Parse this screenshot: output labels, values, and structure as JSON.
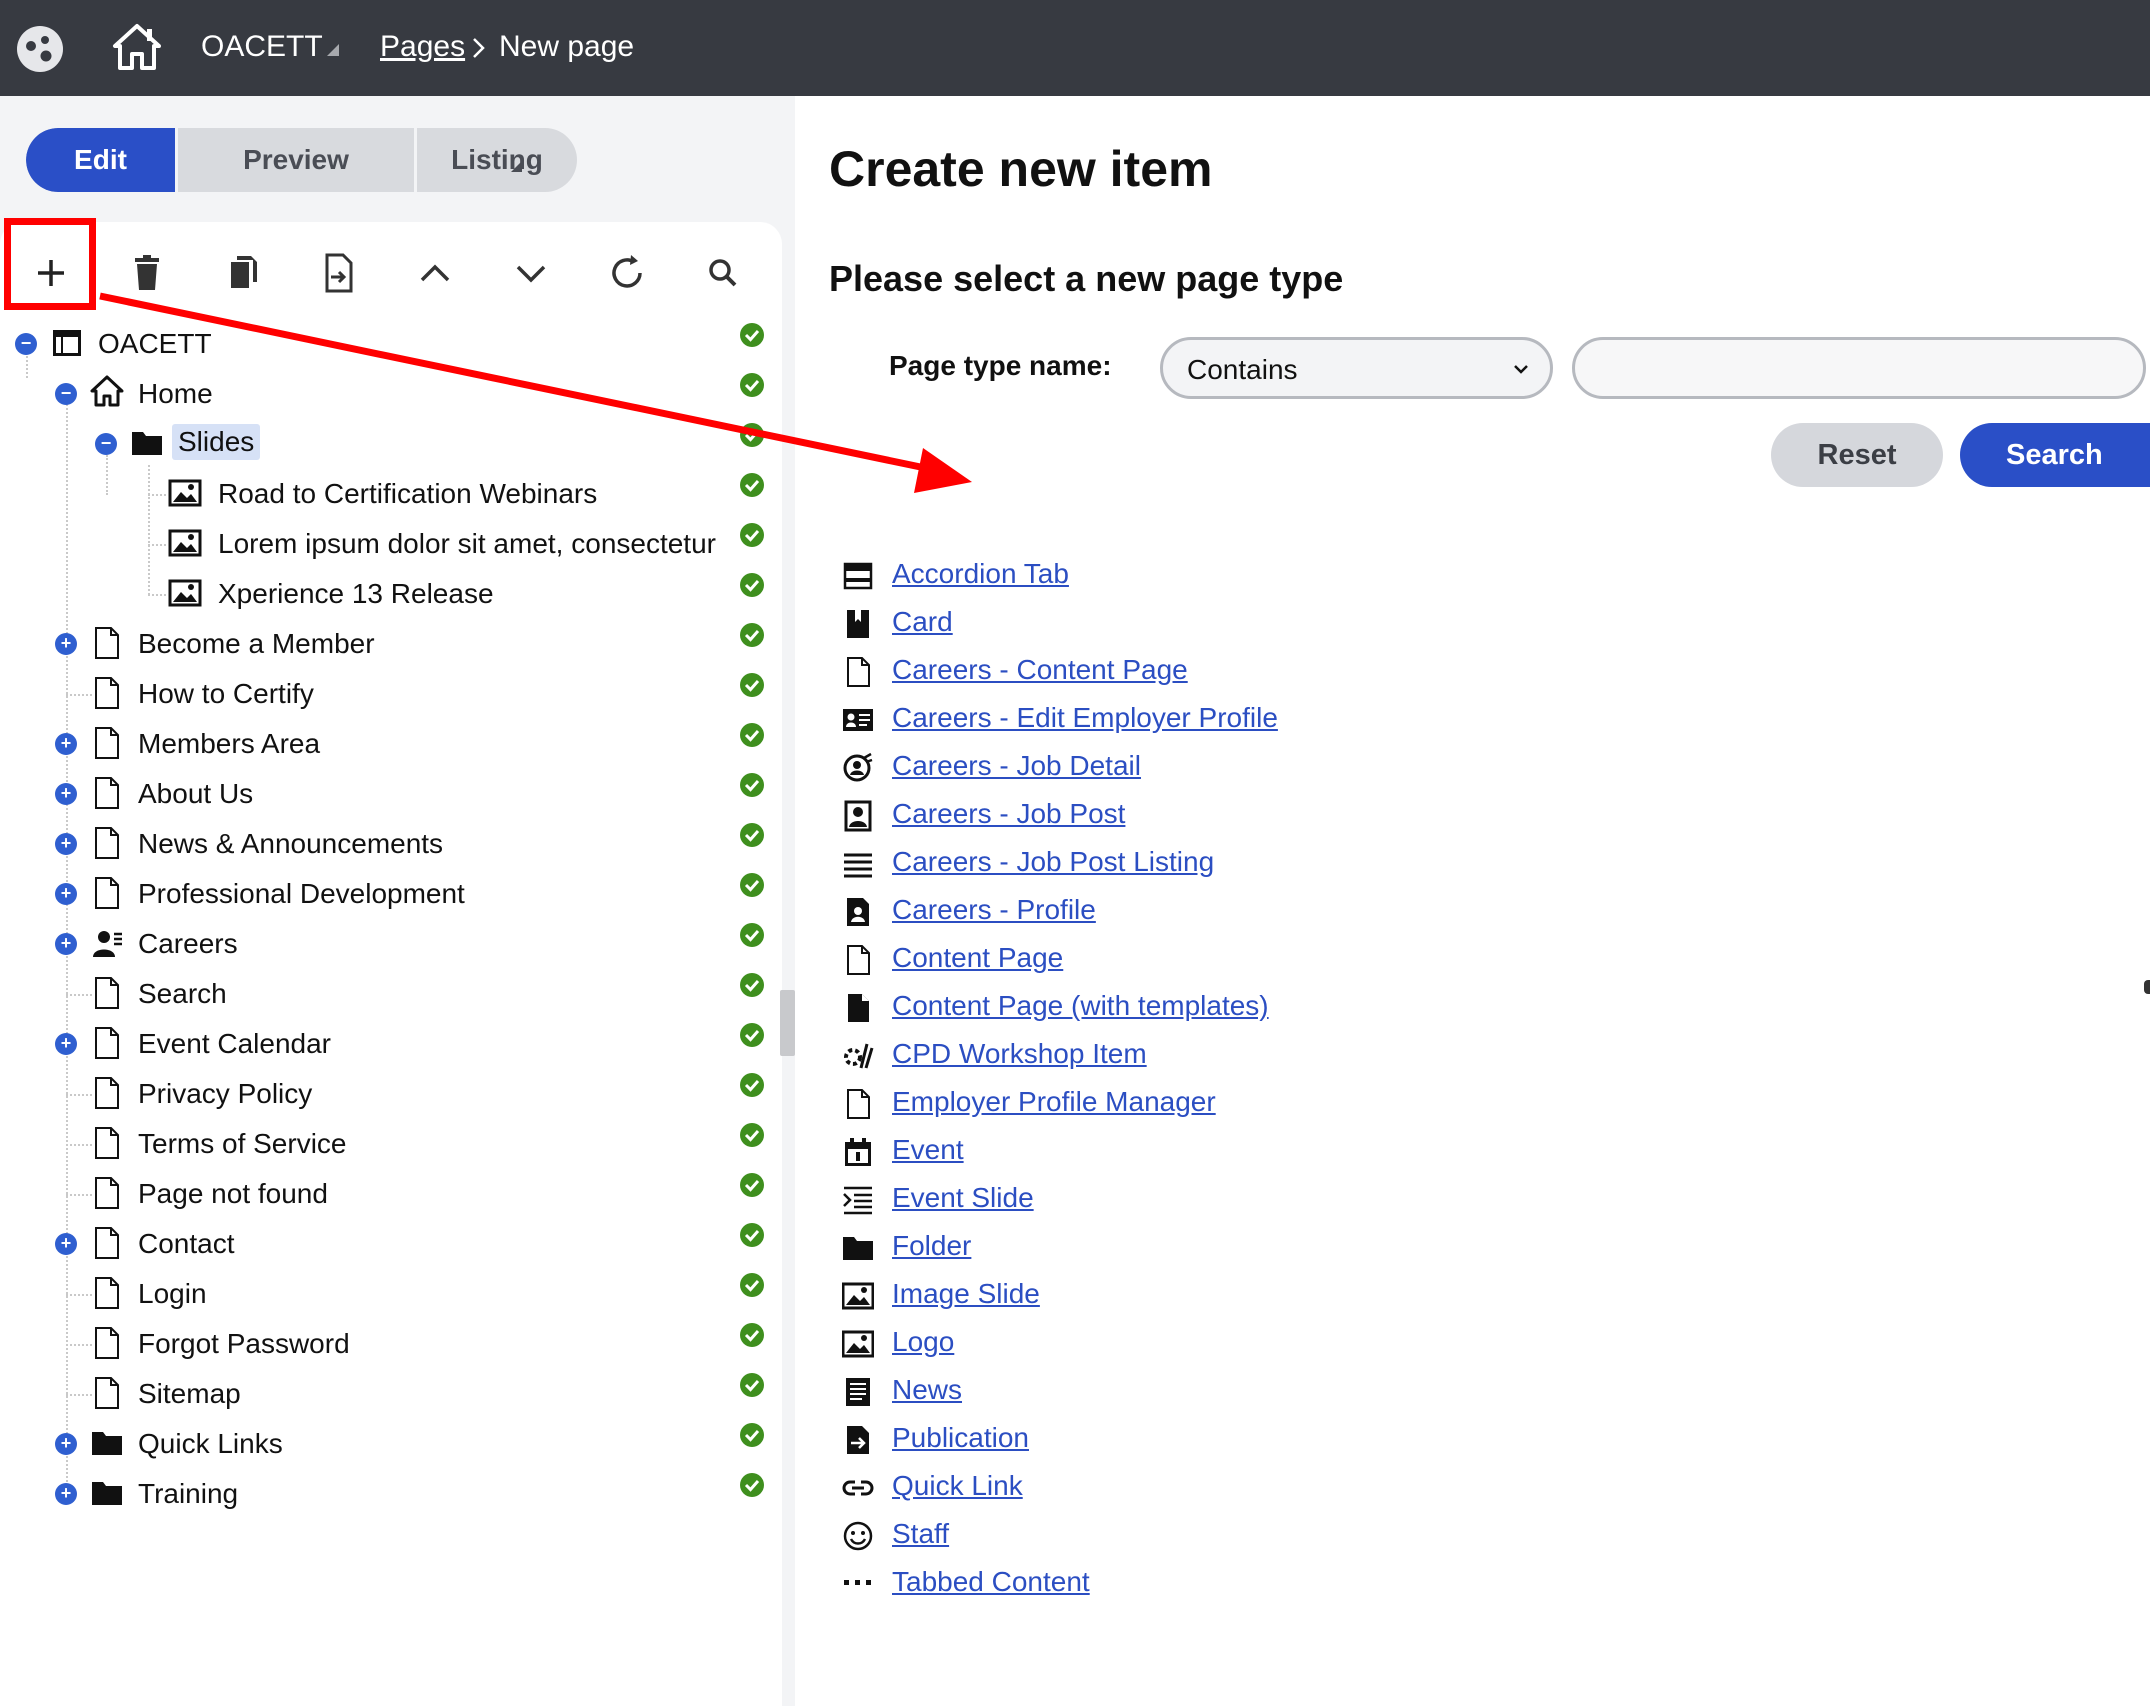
{
  "topbar": {
    "site_name": "OACETT",
    "breadcrumb_pages": "Pages",
    "breadcrumb_current": "New page"
  },
  "mode_tabs": {
    "edit": "Edit",
    "preview": "Preview",
    "listing": "Listing"
  },
  "toolbar": {
    "icons": [
      "plus-icon",
      "trash-icon",
      "copy-icon",
      "move-icon",
      "arrow-up-icon",
      "arrow-down-icon",
      "refresh-icon",
      "search-icon"
    ]
  },
  "tree": {
    "root": "OACETT",
    "home": "Home",
    "slides": "Slides",
    "slide_children": [
      "Road to Certification Webinars",
      "Lorem ipsum dolor sit amet, consectetur",
      "Xperience 13 Release"
    ],
    "pages": [
      "Become a Member",
      "How to Certify",
      "Members Area",
      "About Us",
      "News & Announcements",
      "Professional Development",
      "Careers",
      "Search",
      "Event Calendar",
      "Privacy Policy",
      "Terms of Service",
      "Page not found",
      "Contact",
      "Login",
      "Forgot Password",
      "Sitemap",
      "Quick Links",
      "Training"
    ]
  },
  "main": {
    "title": "Create new item",
    "subtitle": "Please select a new page type",
    "filter_label": "Page type name:",
    "filter_operator": "Contains",
    "filter_value": "",
    "reset_label": "Reset",
    "search_label": "Search",
    "page_types": [
      "Accordion Tab",
      "Card",
      "Careers - Content Page",
      "Careers - Edit Employer Profile",
      "Careers - Job Detail",
      "Careers - Job Post",
      "Careers - Job Post Listing",
      "Careers - Profile",
      "Content Page",
      "Content Page (with templates)",
      "CPD Workshop Item",
      "Employer Profile Manager",
      "Event",
      "Event Slide",
      "Folder",
      "Image Slide",
      "Logo",
      "News",
      "Publication",
      "Quick Link",
      "Staff",
      "Tabbed Content"
    ]
  },
  "colors": {
    "topbar_bg": "#373a41",
    "accent": "#2a4fc7",
    "link": "#2b4ec2",
    "status_ok": "#3f8f1e",
    "annotation": "#ff0000"
  }
}
